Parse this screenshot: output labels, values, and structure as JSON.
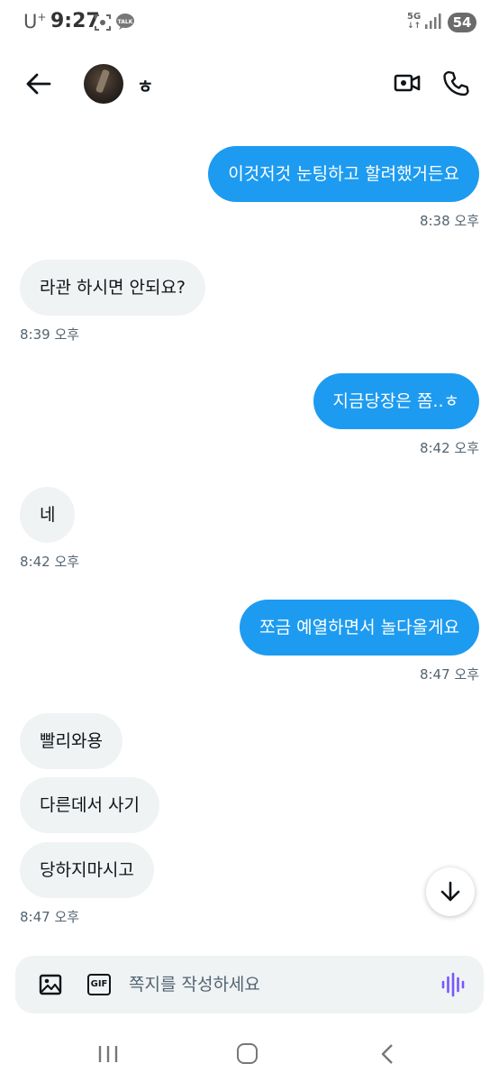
{
  "status_bar": {
    "carrier": "U",
    "carrier_sup": "+",
    "time": "9:27",
    "network": "5G",
    "battery": "54",
    "icons": [
      "screenshot-icon",
      "kakaotalk-icon",
      "signal-icon"
    ]
  },
  "header": {
    "contact_name": "ㅎ",
    "icons": [
      "back-arrow-icon",
      "video-call-icon",
      "phone-icon"
    ]
  },
  "messages": [
    {
      "direction": "out",
      "text": "이것저것 눈팅하고 할려했거든요"
    },
    {
      "direction": "out",
      "time": "8:38 오후"
    },
    {
      "direction": "in",
      "text": "라관 하시면 안되요?"
    },
    {
      "direction": "in",
      "time": "8:39 오후"
    },
    {
      "direction": "out",
      "text": "지금당장은 쫌..ㅎ"
    },
    {
      "direction": "out",
      "time": "8:42 오후"
    },
    {
      "direction": "in",
      "text": "네"
    },
    {
      "direction": "in",
      "time": "8:42 오후"
    },
    {
      "direction": "out",
      "text": "쪼금 예열하면서 놀다올게요"
    },
    {
      "direction": "out",
      "time": "8:47 오후"
    },
    {
      "direction": "in",
      "text": "빨리와용"
    },
    {
      "direction": "in",
      "text": "다른데서 사기"
    },
    {
      "direction": "in",
      "text": "당하지마시고"
    },
    {
      "direction": "in",
      "time": "8:47 오후"
    }
  ],
  "composer": {
    "placeholder": "쪽지를 작성하세요",
    "gif_label": "GIF"
  },
  "colors": {
    "outgoing_bubble": "#1d9bf0",
    "incoming_bubble": "#eff3f4",
    "timestamp": "#536471",
    "voice_icon": "#7856ff"
  }
}
